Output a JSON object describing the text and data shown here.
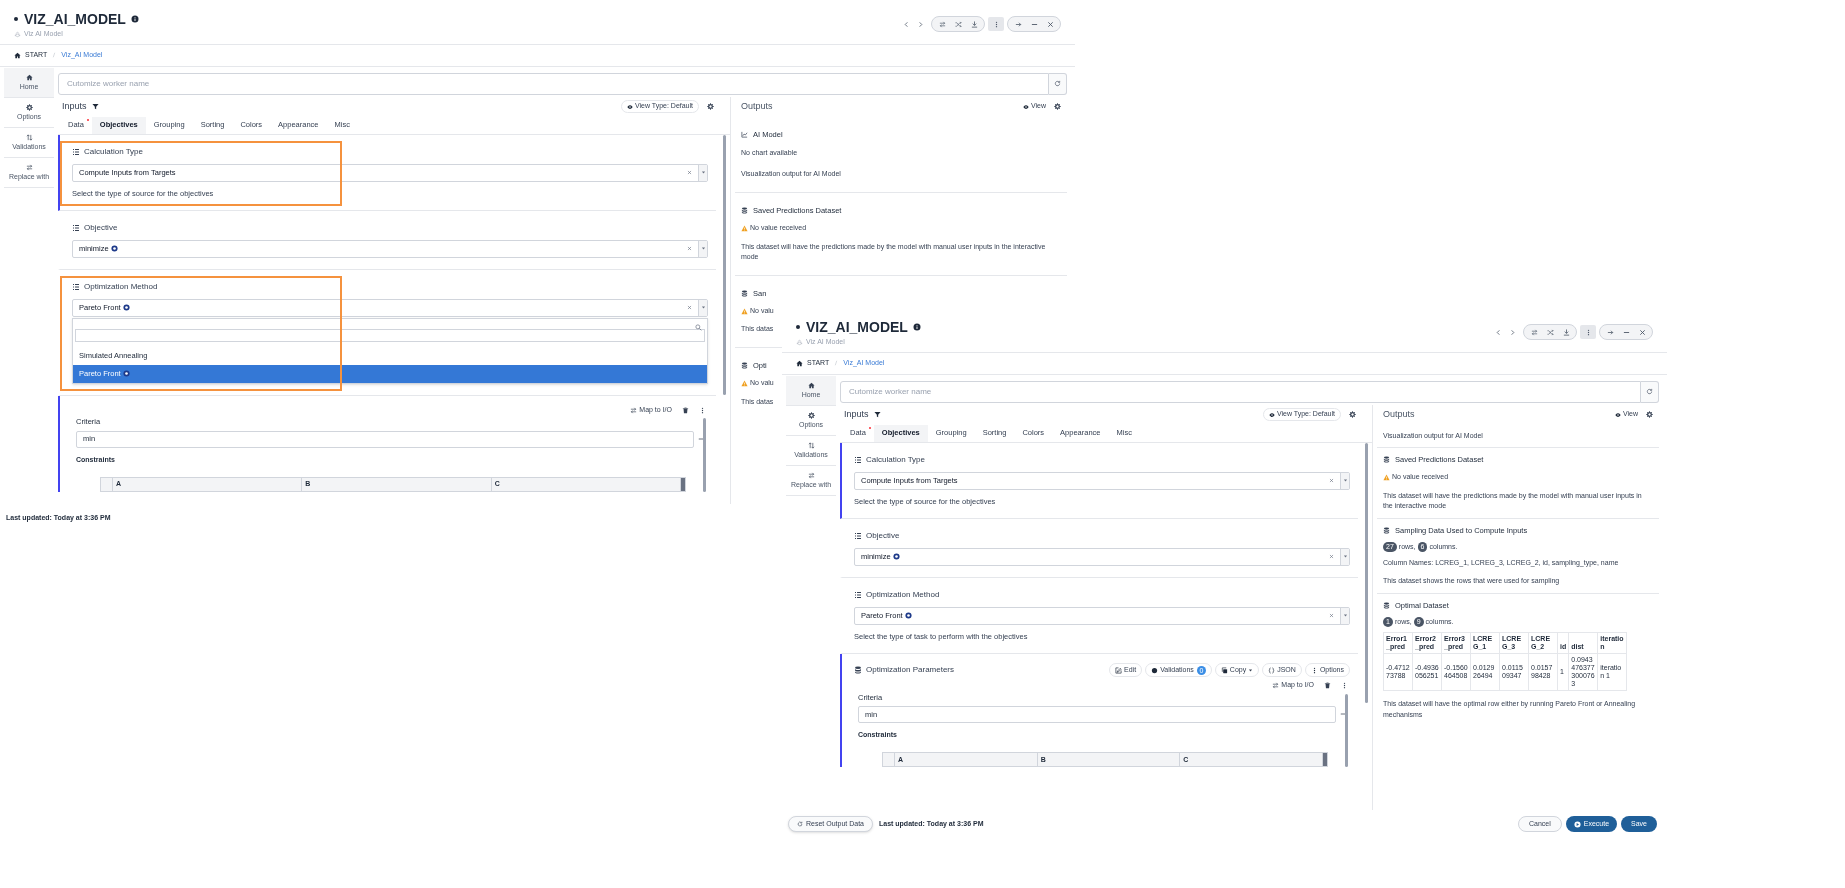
{
  "windows": [
    {
      "title": "VIZ_AI_MODEL",
      "subtitle": "Viz AI Model",
      "breadcrumb": [
        "START",
        "Viz_AI Model"
      ],
      "sidebar": [
        {
          "label": "Home",
          "selected": true
        },
        {
          "label": "Options",
          "selected": false
        },
        {
          "label": "Validations",
          "selected": false
        },
        {
          "label": "Replace with",
          "selected": false
        }
      ],
      "worker_name": {
        "placeholder": "Cutomize worker name"
      },
      "inputs": {
        "title": "Inputs",
        "view_type": "View Type: Default",
        "tabs": [
          {
            "label": "Data",
            "required": true,
            "selected": false
          },
          {
            "label": "Objectives",
            "required": false,
            "selected": true
          },
          {
            "label": "Grouping",
            "required": false,
            "selected": false
          },
          {
            "label": "Sorting",
            "required": false,
            "selected": false
          },
          {
            "label": "Colors",
            "required": false,
            "selected": false
          },
          {
            "label": "Appearance",
            "required": false,
            "selected": false
          },
          {
            "label": "Misc",
            "required": false,
            "selected": false
          }
        ],
        "sections": [
          {
            "kind": "select",
            "title": "Calculation Type",
            "value": "Compute Inputs from Targets",
            "tagged": false,
            "help": "Select the type of source for the objectives",
            "accent": true,
            "highlighted": true
          },
          {
            "kind": "select",
            "title": "Objective",
            "value": "minimize",
            "tagged": true,
            "accent": false,
            "highlighted": false
          },
          {
            "kind": "select",
            "title": "Optimization Method",
            "value": "Pareto Front",
            "tagged": true,
            "accent": false,
            "highlighted": true,
            "dropdown": {
              "options": [
                {
                  "label": "Simulated Annealing",
                  "tagged": false,
                  "selected": false
                },
                {
                  "label": "Pareto Front",
                  "tagged": true,
                  "selected": true
                }
              ]
            }
          },
          {
            "kind": "parameters",
            "accent": true,
            "highlighted": false,
            "map_label": "Map to I/O",
            "criteria_label": "Criteria",
            "criteria_value": "min",
            "constraints_label": "Constraints",
            "columns": [
              "A",
              "B",
              "C"
            ]
          }
        ]
      },
      "outputs": {
        "title": "Outputs",
        "view": "View",
        "items": [
          {
            "kind": "chart",
            "title": "AI Model",
            "message": "No chart available",
            "caption": "Visualization output for AI Model"
          },
          {
            "kind": "dataset",
            "title": "Saved Predictions Dataset",
            "warning": "No value received",
            "description": "This dataset will have the predictions made by the model with manual user inputs in the interactive mode"
          },
          {
            "kind": "dataset",
            "title": "San",
            "warning": "No valu",
            "description": "This datas"
          },
          {
            "kind": "dataset",
            "title": "Opti",
            "warning": "No valu",
            "description": "This datas"
          }
        ]
      },
      "footer": {
        "last_updated": "Last updated: Today at 3:36 PM"
      }
    },
    {
      "title": "VIZ_AI_MODEL",
      "subtitle": "Viz AI Model",
      "breadcrumb": [
        "START",
        "Viz_AI Model"
      ],
      "sidebar": [
        {
          "label": "Home",
          "selected": true
        },
        {
          "label": "Options",
          "selected": false
        },
        {
          "label": "Validations",
          "selected": false
        },
        {
          "label": "Replace with",
          "selected": false
        }
      ],
      "worker_name": {
        "placeholder": "Cutomize worker name"
      },
      "inputs": {
        "title": "Inputs",
        "view_type": "View Type: Default",
        "tabs": [
          {
            "label": "Data",
            "required": true,
            "selected": false
          },
          {
            "label": "Objectives",
            "required": false,
            "selected": true
          },
          {
            "label": "Grouping",
            "required": false,
            "selected": false
          },
          {
            "label": "Sorting",
            "required": false,
            "selected": false
          },
          {
            "label": "Colors",
            "required": false,
            "selected": false
          },
          {
            "label": "Appearance",
            "required": false,
            "selected": false
          },
          {
            "label": "Misc",
            "required": false,
            "selected": false
          }
        ],
        "sections": [
          {
            "kind": "select",
            "title": "Calculation Type",
            "value": "Compute Inputs from Targets",
            "tagged": false,
            "help": "Select the type of source for the objectives",
            "accent": true,
            "highlighted": false
          },
          {
            "kind": "select",
            "title": "Objective",
            "value": "minimize",
            "tagged": true,
            "accent": false,
            "highlighted": false
          },
          {
            "kind": "select",
            "title": "Optimization Method",
            "value": "Pareto Front",
            "tagged": true,
            "help": "Select the type of task to perform with the objectives",
            "accent": false,
            "highlighted": false
          },
          {
            "kind": "parameters",
            "title": "Optimization Parameters",
            "accent": true,
            "highlighted": false,
            "buttons": [
              {
                "label": "Edit",
                "has_menu": false
              },
              {
                "label": "Validations",
                "count": "0",
                "has_menu": false
              },
              {
                "label": "Copy",
                "has_menu": true
              },
              {
                "label": "JSON",
                "has_menu": false
              },
              {
                "label": "Options",
                "has_menu": false
              }
            ],
            "map_label": "Map to I/O",
            "criteria_label": "Criteria",
            "criteria_value": "min",
            "constraints_label": "Constraints",
            "columns": [
              "A",
              "B",
              "C"
            ]
          }
        ]
      },
      "outputs": {
        "title": "Outputs",
        "view": "View",
        "items": [
          {
            "kind": "note",
            "text": "Visualization output for AI Model"
          },
          {
            "kind": "dataset",
            "title": "Saved Predictions Dataset",
            "warning": "No value received",
            "description": "This dataset will have the predictions made by the model with manual user inputs in the interactive mode"
          },
          {
            "kind": "dataset",
            "title": "Sampling Data Used to Compute Inputs",
            "stats": {
              "rows": "27",
              "rows_label": "rows,",
              "columns": "6",
              "columns_label": "columns."
            },
            "columns_text": "Column Names: LCREG_1, LCREG_3, LCREG_2, id, sampling_type, name",
            "description": "This dataset shows the rows that were used for sampling"
          },
          {
            "kind": "dataset",
            "title": "Optimal Dataset",
            "stats": {
              "rows": "1",
              "rows_label": "rows,",
              "columns": "9",
              "columns_label": "columns."
            },
            "table": {
              "columns": [
                "Error1_pred",
                "Error2_pred",
                "Error3_pred",
                "LCREG_1",
                "LCREG_3",
                "LCREG_2",
                "id",
                "dist",
                "iteration"
              ],
              "rows": [
                [
                  "-0.471273788",
                  "-0.4936056251",
                  "-0.1560464508",
                  "0.012926494",
                  "0.011509347",
                  "0.015798428",
                  "1",
                  "0.09434763773000763",
                  "iteration 1"
                ]
              ]
            },
            "description": "This dataset will have the optimal row either by running Pareto Front or Annealing mechanisms"
          }
        ]
      },
      "footer": {
        "last_updated": "Last updated: Today at 3:36 PM",
        "buttons": [
          {
            "label": "Reset Output Data",
            "kind": "reset"
          },
          {
            "label": "Cancel",
            "kind": "cancel"
          },
          {
            "label": "Execute",
            "kind": "execute"
          },
          {
            "label": "Save",
            "kind": "save"
          }
        ]
      }
    }
  ]
}
